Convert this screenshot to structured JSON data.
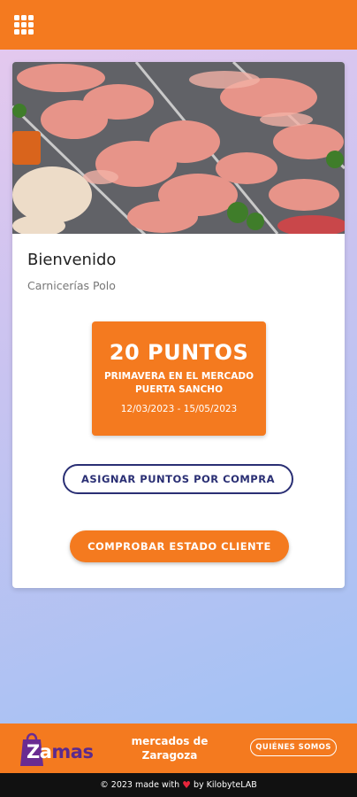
{
  "header": {
    "menu_icon": "apps-grid-icon"
  },
  "card": {
    "hero_image": "meat-display-photo",
    "welcome": "Bienvenido",
    "store_name": "Carnicerías Polo",
    "promo": {
      "points": "20 PUNTOS",
      "title": "PRIMAVERA EN EL MERCADO PUERTA SANCHO",
      "dates": "12/03/2023 - 15/05/2023"
    },
    "assign_button": "ASIGNAR PUNTOS POR COMPRA",
    "check_button": "COMPROBAR ESTADO CLIENTE"
  },
  "footer": {
    "logo_za": "Za",
    "logo_mas": "mas",
    "mercados": "mercados de Zaragoza",
    "quienes_button": "QUIÉNES SOMOS"
  },
  "bottom": {
    "made_prefix": "© 2023 made with",
    "made_suffix": "by KilobyteLAB"
  },
  "colors": {
    "brand_orange": "#f47a1f",
    "navy": "#2a2f74",
    "logo_purple": "#5b2a8e"
  }
}
